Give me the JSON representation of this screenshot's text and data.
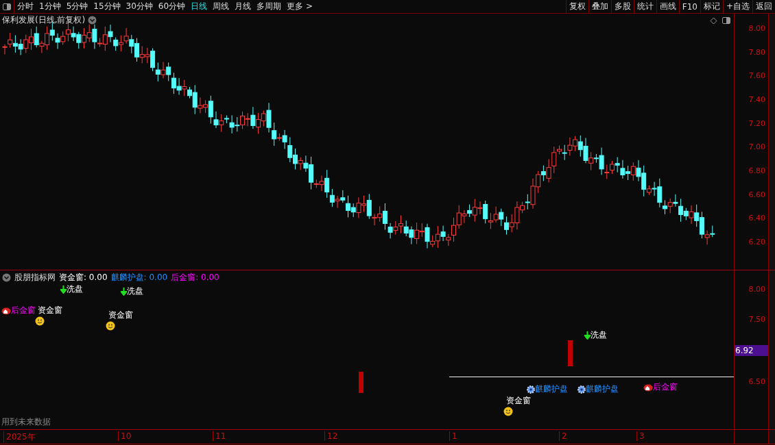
{
  "toolbar": {
    "periods": [
      {
        "label": "分时",
        "selected": false
      },
      {
        "label": "1分钟",
        "selected": false
      },
      {
        "label": "5分钟",
        "selected": false
      },
      {
        "label": "15分钟",
        "selected": false
      },
      {
        "label": "30分钟",
        "selected": false
      },
      {
        "label": "60分钟",
        "selected": false
      },
      {
        "label": "日线",
        "selected": true
      },
      {
        "label": "周线",
        "selected": false
      },
      {
        "label": "月线",
        "selected": false
      },
      {
        "label": "多周期",
        "selected": false
      },
      {
        "label": "更多 >",
        "selected": false
      }
    ],
    "buttons": [
      "复权",
      "叠加",
      "多股",
      "统计",
      "画线",
      "F10",
      "标记",
      "+自选",
      "返回"
    ]
  },
  "main_chart": {
    "title": "保利发展(日线,前复权)",
    "price_ticks": [
      "8.00",
      "7.80",
      "7.60",
      "7.40",
      "7.20",
      "7.00",
      "6.80",
      "6.60",
      "6.40",
      "6.20"
    ]
  },
  "indicator": {
    "name": "股朋指标网",
    "legend": [
      {
        "label": "资金窗:",
        "value": "0.00",
        "color": "#ffffff"
      },
      {
        "label": "麒麟护盘:",
        "value": "0.00",
        "color": "#1e90ff"
      },
      {
        "label": "后金窗:",
        "value": "0.00",
        "color": "#ff00ff"
      }
    ],
    "ticks": [
      "8.00",
      "7.50",
      "6.50"
    ],
    "current_price": "6.92",
    "markers": [
      {
        "kind": "late",
        "label": "后金窗"
      },
      {
        "kind": "wash",
        "label": "洗盘"
      },
      {
        "kind": "fund",
        "label": "资金窗"
      },
      {
        "kind": "wash",
        "label": "洗盘"
      },
      {
        "kind": "fund",
        "label": "资金窗"
      },
      {
        "kind": "fund",
        "label": "资金窗"
      },
      {
        "kind": "guard",
        "label": "麒麟护盘"
      },
      {
        "kind": "guard",
        "label": "麒麟护盘"
      },
      {
        "kind": "wash",
        "label": "洗盘"
      },
      {
        "kind": "late",
        "label": "后金窗"
      }
    ],
    "note": "用到未来数据"
  },
  "time_axis": [
    "2025年",
    "10",
    "11",
    "12",
    "1",
    "2",
    "3"
  ]
}
